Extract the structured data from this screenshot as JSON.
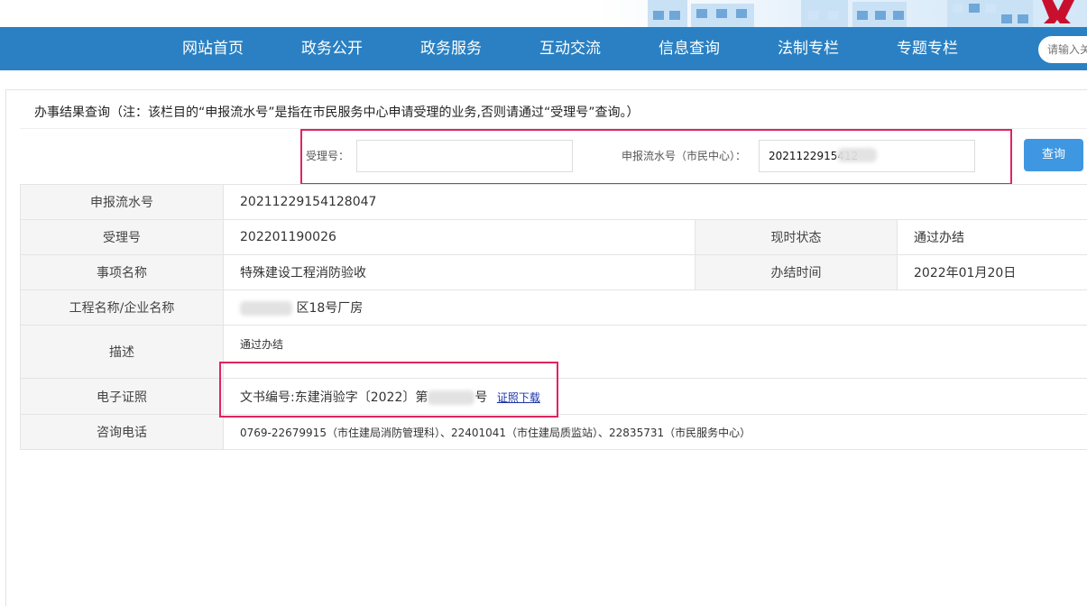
{
  "nav": {
    "items": [
      "网站首页",
      "政务公开",
      "政务服务",
      "互动交流",
      "信息查询",
      "法制专栏",
      "专题专栏"
    ],
    "search_placeholder": "请输入关"
  },
  "notice": "办事结果查询（注：该栏目的“申报流水号”是指在市民服务中心申请受理的业务,否则请通过“受理号”查询。）",
  "query": {
    "accept_label": "受理号：",
    "accept_value": "",
    "serial_label": "申报流水号（市民中心）：",
    "serial_value": "2021122915412",
    "button": "查询"
  },
  "result": {
    "serial_label": "申报流水号",
    "serial_value": "20211229154128047",
    "accept_label": "受理号",
    "accept_value": "202201190026",
    "status_label": "现时状态",
    "status_value": "通过办结",
    "item_label": "事项名称",
    "item_value": "特殊建设工程消防验收",
    "finish_label": "办结时间",
    "finish_value": "2022年01月20日",
    "project_label": "工程名称/企业名称",
    "project_value": "区18号厂房",
    "desc_label": "描述",
    "desc_value": "通过办结",
    "cert_label": "电子证照",
    "cert_prefix": "文书编号:东建消验字〔2022〕第",
    "cert_suffix": "号",
    "cert_link": "证照下载",
    "phone_label": "咨询电话",
    "phone_value": "0769-22679915（市住建局消防管理科）、22401041（市住建局质监站）、22835731（市民服务中心）"
  },
  "colors": {
    "nav_bg": "#2a80c2",
    "highlight_box": "#e0245e",
    "query_button": "#3f97e2",
    "link": "#1a35a8"
  }
}
